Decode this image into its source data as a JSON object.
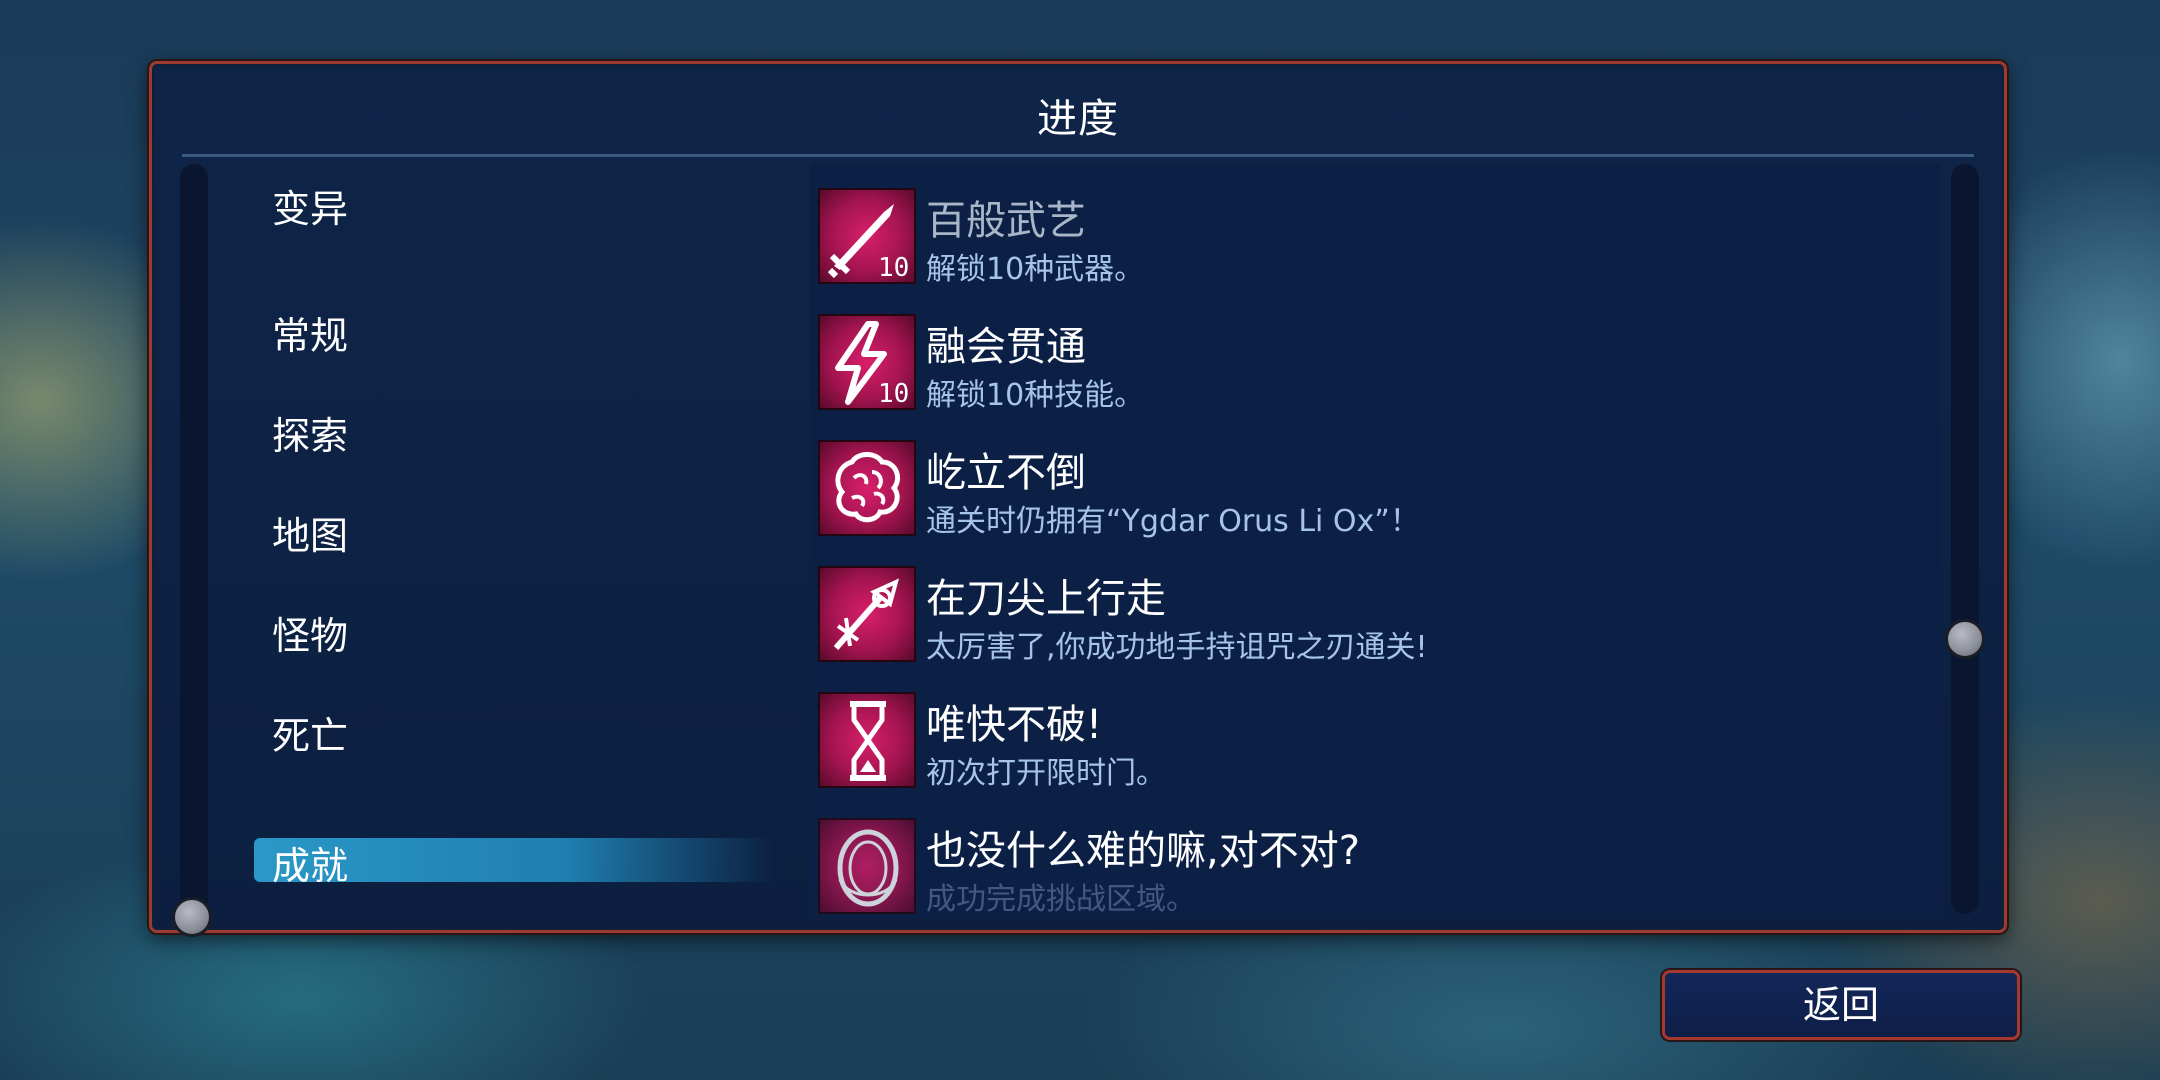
{
  "panel": {
    "title": "进度"
  },
  "categories": [
    {
      "label": "变异"
    },
    {
      "label": "常规"
    },
    {
      "label": "探索"
    },
    {
      "label": "地图"
    },
    {
      "label": "怪物"
    },
    {
      "label": "死亡"
    },
    {
      "label": "成就",
      "selected": true
    }
  ],
  "achievements": [
    {
      "name": "百般武艺",
      "desc": "解锁10种武器。",
      "icon": "sword-10-icon",
      "badge": "10"
    },
    {
      "name": "融会贯通",
      "desc": "解锁10种技能。",
      "icon": "lightning-10-icon",
      "badge": "10"
    },
    {
      "name": "屹立不倒",
      "desc": "通关时仍拥有“Ygdar Orus Li Ox”！",
      "icon": "brain-icon"
    },
    {
      "name": "在刀尖上行走",
      "desc": "太厉害了,你成功地手持诅咒之刃通关!",
      "icon": "cursed-blade-icon"
    },
    {
      "name": "唯快不破!",
      "desc": "初次打开限时门。",
      "icon": "hourglass-icon"
    },
    {
      "name": "也没什么难的嘛,对不对?",
      "desc": "成功完成挑战区域。",
      "icon": "ring-portal-icon"
    }
  ],
  "footer": {
    "back_label": "返回"
  },
  "colors": {
    "accent": "#2a98c8",
    "icon_bg": "#c01a5e",
    "border": "#9b3b32",
    "desc_text": "#a6c3e8"
  }
}
